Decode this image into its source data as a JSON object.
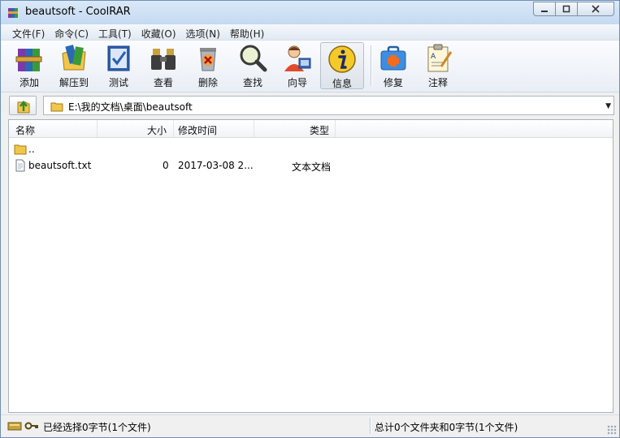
{
  "window": {
    "title": "beautsoft - CoolRAR",
    "icon": "winrar-books-icon"
  },
  "menu": [
    {
      "label": "文件(F)"
    },
    {
      "label": "命令(C)"
    },
    {
      "label": "工具(T)"
    },
    {
      "label": "收藏(O)"
    },
    {
      "label": "选项(N)"
    },
    {
      "label": "帮助(H)"
    }
  ],
  "toolbar": [
    {
      "label": "添加",
      "icon": "add-archive-icon"
    },
    {
      "label": "解压到",
      "icon": "extract-to-icon"
    },
    {
      "label": "测试",
      "icon": "test-icon"
    },
    {
      "label": "查看",
      "icon": "view-binoculars-icon"
    },
    {
      "label": "删除",
      "icon": "delete-icon"
    },
    {
      "label": "查找",
      "icon": "find-magnifier-icon"
    },
    {
      "label": "向导",
      "icon": "wizard-icon"
    },
    {
      "label": "信息",
      "icon": "info-icon"
    },
    {
      "label": "修复",
      "icon": "repair-icon"
    },
    {
      "label": "注释",
      "icon": "comment-icon"
    }
  ],
  "address": {
    "path": "E:\\我的文档\\桌面\\beautsoft"
  },
  "columns": {
    "name": "名称",
    "size": "大小",
    "modified": "修改时间",
    "type": "类型"
  },
  "files": [
    {
      "name": "..",
      "size": "",
      "modified": "",
      "type": "",
      "icon": "folder-up-icon"
    },
    {
      "name": "beautsoft.txt",
      "size": "0",
      "modified": "2017-03-08 2...",
      "type": "文本文档",
      "icon": "text-file-icon"
    }
  ],
  "status": {
    "left": "已经选择0字节(1个文件)",
    "right": "总计0个文件夹和0字节(1个文件)"
  }
}
